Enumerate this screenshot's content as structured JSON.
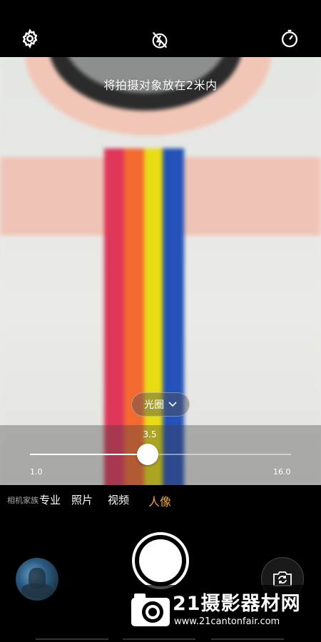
{
  "top_bar": {
    "settings_icon": "gear-icon",
    "flash_icon": "flash-off-icon",
    "timer_icon": "timer-icon"
  },
  "viewfinder": {
    "hint_text": "将拍摄对象放在2米内"
  },
  "aperture": {
    "label": "光圈",
    "value_label": "3.5",
    "min_label": "1.0",
    "max_label": "16.0",
    "level_fraction": 0.45
  },
  "modes": {
    "items": [
      "相机家族",
      "专业",
      "照片",
      "视频",
      "人像"
    ],
    "active": "人像"
  },
  "bottom": {
    "gallery_icon": "gallery-thumbnail",
    "switch_camera_icon": "switch-camera-icon"
  },
  "watermark": {
    "title": "21摄影器材网",
    "url": "www.21cantonfair.com"
  },
  "colors": {
    "accent": "#f2a53c",
    "background": "#000000"
  }
}
